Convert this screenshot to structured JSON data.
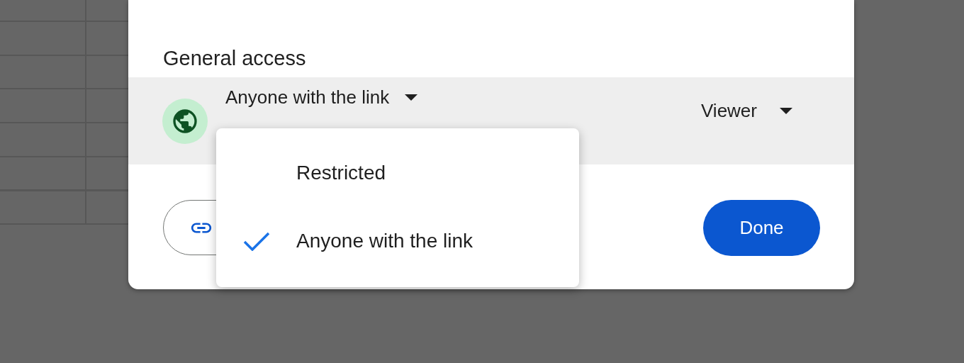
{
  "dialog": {
    "section_title": "General access",
    "access": {
      "label": "Anyone with the link",
      "role": "Viewer"
    },
    "done_button": "Done"
  },
  "menu": {
    "items": [
      {
        "label": "Restricted",
        "selected": false
      },
      {
        "label": "Anyone with the link",
        "selected": true
      }
    ]
  }
}
